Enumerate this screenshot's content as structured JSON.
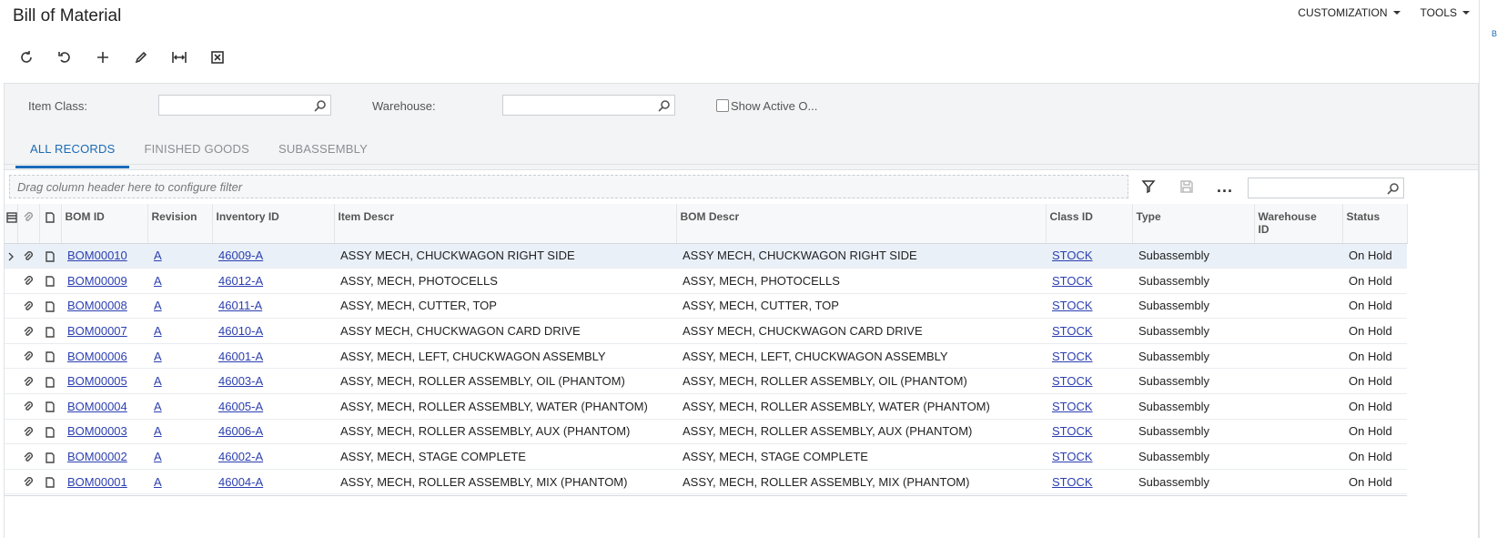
{
  "header": {
    "title": "Bill of Material",
    "menus": [
      {
        "label": "CUSTOMIZATION"
      },
      {
        "label": "TOOLS"
      }
    ],
    "side_link": "Bi"
  },
  "toolbar": {
    "buttons": [
      {
        "name": "refresh-icon"
      },
      {
        "name": "undo-icon"
      },
      {
        "name": "add-icon"
      },
      {
        "name": "edit-icon"
      },
      {
        "name": "fit-width-icon"
      },
      {
        "name": "export-excel-icon"
      }
    ]
  },
  "filters": {
    "item_class_label": "Item Class:",
    "item_class_value": "",
    "warehouse_label": "Warehouse:",
    "warehouse_value": "",
    "show_active_label": "Show Active O...",
    "show_active_checked": false
  },
  "tabs": [
    {
      "label": "ALL RECORDS",
      "active": true
    },
    {
      "label": "FINISHED GOODS",
      "active": false
    },
    {
      "label": "SUBASSEMBLY",
      "active": false
    }
  ],
  "grid": {
    "group_placeholder": "Drag column header here to configure filter",
    "search_value": "",
    "columns": {
      "bom_id": "BOM ID",
      "revision": "Revision",
      "inventory_id": "Inventory ID",
      "item_descr": "Item Descr",
      "bom_descr": "BOM Descr",
      "class_id": "Class ID",
      "type": "Type",
      "warehouse_id": "Warehouse ID",
      "status": "Status"
    },
    "rows": [
      {
        "bom_id": "BOM00010",
        "revision": "A",
        "inventory_id": "46009-A",
        "item_descr": "ASSY MECH, CHUCKWAGON RIGHT SIDE",
        "bom_descr": "ASSY MECH, CHUCKWAGON RIGHT SIDE",
        "class_id": "STOCK",
        "type": "Subassembly",
        "warehouse_id": "",
        "status": "On Hold"
      },
      {
        "bom_id": "BOM00009",
        "revision": "A",
        "inventory_id": "46012-A",
        "item_descr": "ASSY, MECH, PHOTOCELLS",
        "bom_descr": "ASSY, MECH, PHOTOCELLS",
        "class_id": "STOCK",
        "type": "Subassembly",
        "warehouse_id": "",
        "status": "On Hold"
      },
      {
        "bom_id": "BOM00008",
        "revision": "A",
        "inventory_id": "46011-A",
        "item_descr": "ASSY, MECH, CUTTER, TOP",
        "bom_descr": "ASSY, MECH, CUTTER, TOP",
        "class_id": "STOCK",
        "type": "Subassembly",
        "warehouse_id": "",
        "status": "On Hold"
      },
      {
        "bom_id": "BOM00007",
        "revision": "A",
        "inventory_id": "46010-A",
        "item_descr": "ASSY MECH, CHUCKWAGON CARD DRIVE",
        "bom_descr": "ASSY MECH, CHUCKWAGON CARD DRIVE",
        "class_id": "STOCK",
        "type": "Subassembly",
        "warehouse_id": "",
        "status": "On Hold"
      },
      {
        "bom_id": "BOM00006",
        "revision": "A",
        "inventory_id": "46001-A",
        "item_descr": "ASSY, MECH, LEFT, CHUCKWAGON ASSEMBLY",
        "bom_descr": "ASSY, MECH, LEFT, CHUCKWAGON ASSEMBLY",
        "class_id": "STOCK",
        "type": "Subassembly",
        "warehouse_id": "",
        "status": "On Hold"
      },
      {
        "bom_id": "BOM00005",
        "revision": "A",
        "inventory_id": "46003-A",
        "item_descr": "ASSY, MECH, ROLLER ASSEMBLY, OIL (PHANTOM)",
        "bom_descr": "ASSY, MECH, ROLLER ASSEMBLY, OIL (PHANTOM)",
        "class_id": "STOCK",
        "type": "Subassembly",
        "warehouse_id": "",
        "status": "On Hold"
      },
      {
        "bom_id": "BOM00004",
        "revision": "A",
        "inventory_id": "46005-A",
        "item_descr": "ASSY, MECH, ROLLER ASSEMBLY, WATER (PHANTOM)",
        "bom_descr": "ASSY, MECH, ROLLER ASSEMBLY, WATER (PHANTOM)",
        "class_id": "STOCK",
        "type": "Subassembly",
        "warehouse_id": "",
        "status": "On Hold"
      },
      {
        "bom_id": "BOM00003",
        "revision": "A",
        "inventory_id": "46006-A",
        "item_descr": "ASSY, MECH, ROLLER ASSEMBLY, AUX (PHANTOM)",
        "bom_descr": "ASSY, MECH, ROLLER ASSEMBLY, AUX (PHANTOM)",
        "class_id": "STOCK",
        "type": "Subassembly",
        "warehouse_id": "",
        "status": "On Hold"
      },
      {
        "bom_id": "BOM00002",
        "revision": "A",
        "inventory_id": "46002-A",
        "item_descr": "ASSY, MECH, STAGE COMPLETE",
        "bom_descr": "ASSY, MECH, STAGE COMPLETE",
        "class_id": "STOCK",
        "type": "Subassembly",
        "warehouse_id": "",
        "status": "On Hold"
      },
      {
        "bom_id": "BOM00001",
        "revision": "A",
        "inventory_id": "46004-A",
        "item_descr": "ASSY, MECH, ROLLER ASSEMBLY, MIX (PHANTOM)",
        "bom_descr": "ASSY, MECH, ROLLER ASSEMBLY, MIX (PHANTOM)",
        "class_id": "STOCK",
        "type": "Subassembly",
        "warehouse_id": "",
        "status": "On Hold"
      }
    ],
    "selected_row": 0
  },
  "colors": {
    "accent": "#1a6bb8",
    "link": "#2c3fb0",
    "selected_row": "#e9f0f8"
  }
}
